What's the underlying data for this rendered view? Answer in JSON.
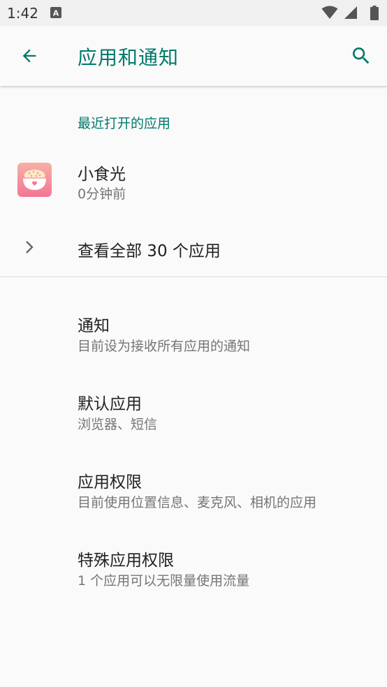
{
  "status_bar": {
    "time": "1:42",
    "icons": [
      "a-notification-icon",
      "wifi-icon",
      "signal-icon",
      "battery-icon"
    ]
  },
  "toolbar": {
    "title": "应用和通知",
    "back_icon": "back-arrow-icon",
    "search_icon": "search-icon",
    "accent_color": "#00796b"
  },
  "recent_apps": {
    "header": "最近打开的应用",
    "items": [
      {
        "name": "小食光",
        "time": "0分钟前",
        "icon": "rice-bowl-app-icon"
      }
    ],
    "see_all": "查看全部 30 个应用"
  },
  "settings": [
    {
      "title": "通知",
      "summary": "目前设为接收所有应用的通知"
    },
    {
      "title": "默认应用",
      "summary": "浏览器、短信"
    },
    {
      "title": "应用权限",
      "summary": "目前使用位置信息、麦克风、相机的应用"
    },
    {
      "title": "特殊应用权限",
      "summary": "1 个应用可以无限量使用流量"
    }
  ]
}
